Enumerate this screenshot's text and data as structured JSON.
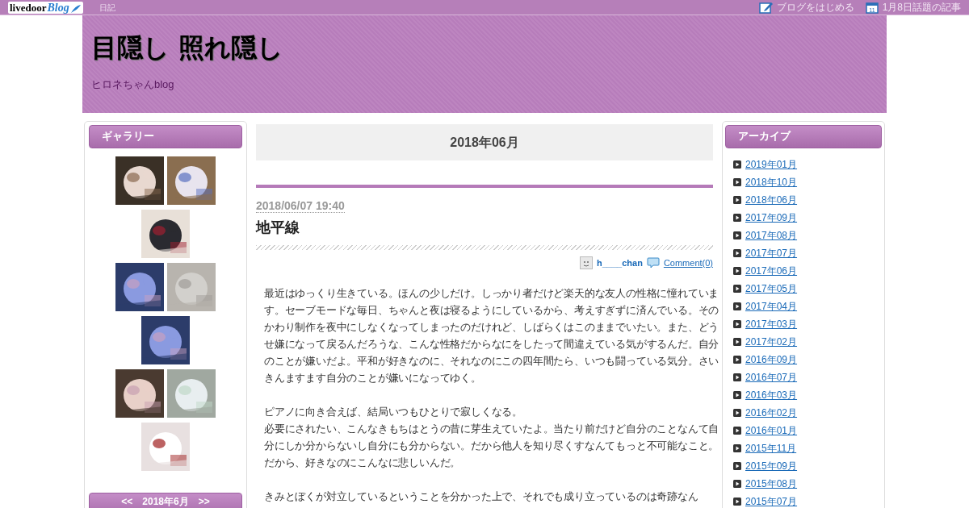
{
  "topbar": {
    "logo_text": "livedoor",
    "logo_script": "Blog",
    "nav_link": "日記",
    "links": [
      {
        "kind": "pen",
        "label": "ブログをはじめる"
      },
      {
        "kind": "calendar",
        "label": "1月8日話題の記事",
        "calendar_day": "11"
      }
    ]
  },
  "header": {
    "title": "目隠し 照れ隠し",
    "subtitle": "ヒロネちゃんblog"
  },
  "gallery": {
    "title": "ギャラリー"
  },
  "calendar": {
    "prev": "<<",
    "month": "2018年6月",
    "next": ">>"
  },
  "main": {
    "heading": "2018年06月",
    "post": {
      "date": "2018/06/07",
      "time": "19:40",
      "title": "地平線",
      "author": "h____chan",
      "comments": "Comment(0)",
      "paragraphs": [
        {
          "lines": [
            "最近はゆっくり生きている。ほんの少しだけ。しっかり者だけど楽天的な友人の性格に憧れています。セーブモードな毎日、ちゃんと夜は寝るようにしているから、考えすぎずに済んでいる。そのかわり制作を夜中にしなくなってしまったのだけれど、しばらくはこのままでいたい。また、どうせ嫌になって戻るんだろうな、こんな性格だからなにをしたって間違えている気がするんだ。自分のことが嫌いだよ。平和が好きなのに、それなのにこの四年間たら、いつも闘っている気分。さいきんますます自分のことが嫌いになってゆく。"
          ]
        },
        {
          "lines": [
            "ピアノに向き合えば、結局いつもひとりで寂しくなる。",
            "必要にされたい、こんなきもちはとうの昔に芽生えていたよ。当たり前だけど自分のことなんて自分にしか分からないし自分にも分からない。だから他人を知り尽くすなんてもっと不可能なこと。だから、好きなのにこんなに悲しいんだ。"
          ]
        },
        {
          "lines": [
            "きみとぼくが対立しているということを分かった上で、それでも成り立っているのは奇跡なん"
          ]
        }
      ]
    }
  },
  "archive": {
    "title": "アーカイブ",
    "items": [
      "2019年01月",
      "2018年10月",
      "2018年06月",
      "2017年09月",
      "2017年08月",
      "2017年07月",
      "2017年06月",
      "2017年05月",
      "2017年04月",
      "2017年03月",
      "2017年02月",
      "2016年09月",
      "2016年07月",
      "2016年03月",
      "2016年02月",
      "2016年01月",
      "2015年11月",
      "2015年09月",
      "2015年08月",
      "2015年07月"
    ]
  }
}
